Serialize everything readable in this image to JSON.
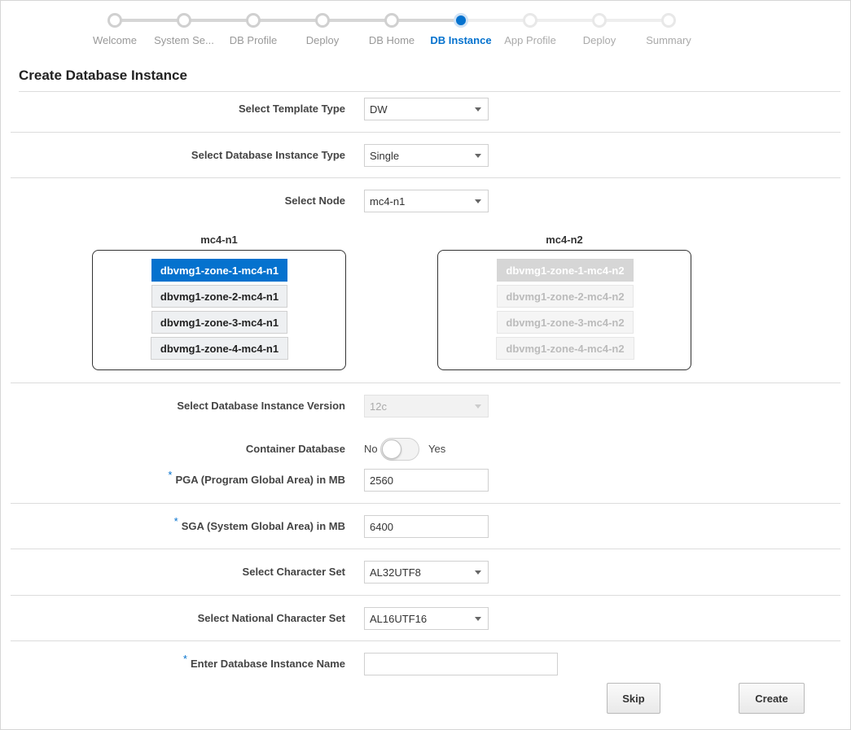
{
  "train": {
    "steps": [
      {
        "label": "Welcome",
        "state": "done"
      },
      {
        "label": "System Se...",
        "state": "done"
      },
      {
        "label": "DB Profile",
        "state": "done"
      },
      {
        "label": "Deploy",
        "state": "done"
      },
      {
        "label": "DB Home",
        "state": "done"
      },
      {
        "label": "DB Instance",
        "state": "current"
      },
      {
        "label": "App Profile",
        "state": "todo"
      },
      {
        "label": "Deploy",
        "state": "todo"
      },
      {
        "label": "Summary",
        "state": "todo"
      }
    ]
  },
  "page_title": "Create Database Instance",
  "form": {
    "template_type": {
      "label": "Select Template Type",
      "value": "DW"
    },
    "instance_type": {
      "label": "Select Database Instance Type",
      "value": "Single"
    },
    "node": {
      "label": "Select Node",
      "value": "mc4-n1"
    },
    "version": {
      "label": "Select Database Instance Version",
      "value": "12c"
    },
    "container_db": {
      "label": "Container Database",
      "off_label": "No",
      "on_label": "Yes"
    },
    "pga": {
      "required_mark": "*",
      "label": "PGA (Program Global Area) in MB",
      "value": "2560"
    },
    "sga": {
      "required_mark": "*",
      "label": "SGA (System Global Area) in MB",
      "value": "6400"
    },
    "charset": {
      "label": "Select Character Set",
      "value": "AL32UTF8"
    },
    "national_charset": {
      "label": "Select National Character Set",
      "value": "AL16UTF16"
    },
    "instance_name": {
      "required_mark": "*",
      "label": "Enter Database Instance Name",
      "value": ""
    }
  },
  "nodes": [
    {
      "title": "mc4-n1",
      "zones": [
        {
          "label": "dbvmg1-zone-1-mc4-n1",
          "state": "selected"
        },
        {
          "label": "dbvmg1-zone-2-mc4-n1",
          "state": "normal"
        },
        {
          "label": "dbvmg1-zone-3-mc4-n1",
          "state": "normal"
        },
        {
          "label": "dbvmg1-zone-4-mc4-n1",
          "state": "normal"
        }
      ]
    },
    {
      "title": "mc4-n2",
      "zones": [
        {
          "label": "dbvmg1-zone-1-mc4-n2",
          "state": "disabled-selected"
        },
        {
          "label": "dbvmg1-zone-2-mc4-n2",
          "state": "disabled"
        },
        {
          "label": "dbvmg1-zone-3-mc4-n2",
          "state": "disabled"
        },
        {
          "label": "dbvmg1-zone-4-mc4-n2",
          "state": "disabled"
        }
      ]
    }
  ],
  "buttons": {
    "skip": "Skip",
    "create": "Create"
  },
  "colors": {
    "accent": "#0572ce"
  }
}
